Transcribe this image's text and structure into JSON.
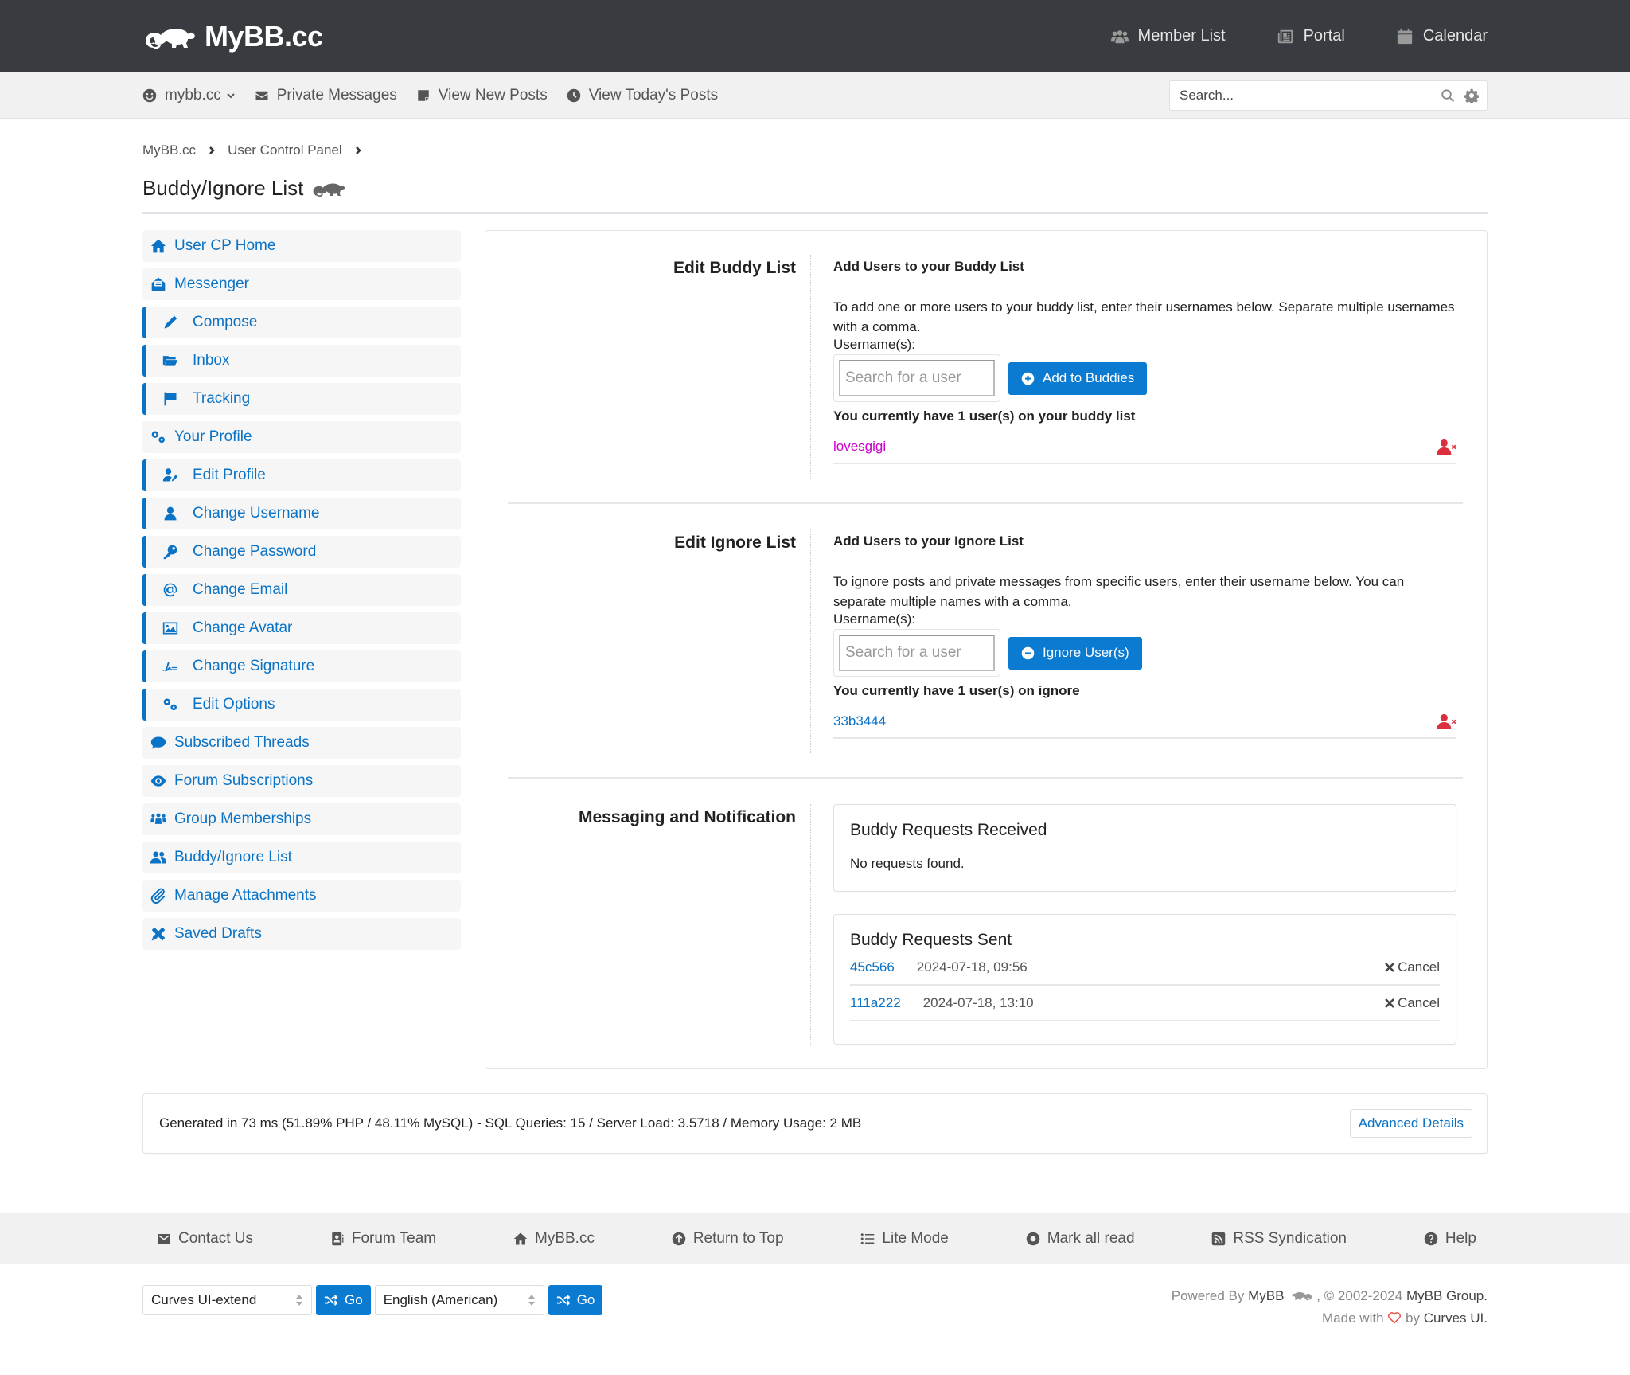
{
  "header": {
    "logo_text": "MyBB.cc",
    "nav": [
      {
        "label": "Member List",
        "icon": "users-icon"
      },
      {
        "label": "Portal",
        "icon": "newspaper-icon"
      },
      {
        "label": "Calendar",
        "icon": "calendar-icon"
      }
    ]
  },
  "subnav": {
    "user_menu": "mybb.cc",
    "links": [
      {
        "label": "Private Messages",
        "icon": "envelope-icon"
      },
      {
        "label": "View New Posts",
        "icon": "sticky-note-icon"
      },
      {
        "label": "View Today's Posts",
        "icon": "clock-icon"
      }
    ],
    "search_placeholder": "Search..."
  },
  "breadcrumb": [
    "MyBB.cc",
    "User Control Panel"
  ],
  "page_title": "Buddy/Ignore List",
  "sidebar": {
    "items": [
      {
        "label": "User CP Home",
        "icon": "home-icon",
        "sub": false
      },
      {
        "label": "Messenger",
        "icon": "envelope-open-icon",
        "sub": false
      },
      {
        "label": "Compose",
        "icon": "pen-icon",
        "sub": true
      },
      {
        "label": "Inbox",
        "icon": "folder-open-icon",
        "sub": true
      },
      {
        "label": "Tracking",
        "icon": "flag-icon",
        "sub": true
      },
      {
        "label": "Your Profile",
        "icon": "cogs-icon",
        "sub": false
      },
      {
        "label": "Edit Profile",
        "icon": "user-edit-icon",
        "sub": true
      },
      {
        "label": "Change Username",
        "icon": "user-icon",
        "sub": true
      },
      {
        "label": "Change Password",
        "icon": "key-icon",
        "sub": true
      },
      {
        "label": "Change Email",
        "icon": "at-icon",
        "sub": true
      },
      {
        "label": "Change Avatar",
        "icon": "image-icon",
        "sub": true
      },
      {
        "label": "Change Signature",
        "icon": "signature-icon",
        "sub": true
      },
      {
        "label": "Edit Options",
        "icon": "cogs-icon",
        "sub": true
      },
      {
        "label": "Subscribed Threads",
        "icon": "comment-icon",
        "sub": false
      },
      {
        "label": "Forum Subscriptions",
        "icon": "eye-icon",
        "sub": false
      },
      {
        "label": "Group Memberships",
        "icon": "users-group-icon",
        "sub": false
      },
      {
        "label": "Buddy/Ignore List",
        "icon": "user-friends-icon",
        "sub": false
      },
      {
        "label": "Manage Attachments",
        "icon": "paperclip-icon",
        "sub": false
      },
      {
        "label": "Saved Drafts",
        "icon": "pencil-ruler-icon",
        "sub": false
      }
    ]
  },
  "buddy": {
    "section_label": "Edit Buddy List",
    "title": "Add Users to your Buddy List",
    "description": "To add one or more users to your buddy list, enter their usernames below. Separate multiple usernames with a comma.",
    "field_label": "Username(s):",
    "placeholder": "Search for a user",
    "button": "Add to Buddies",
    "count_text": "You currently have 1 user(s) on your buddy list",
    "users": [
      {
        "name": "lovesgigi",
        "color": "#cc00cc"
      }
    ]
  },
  "ignore": {
    "section_label": "Edit Ignore List",
    "title": "Add Users to your Ignore List",
    "description": "To ignore posts and private messages from specific users, enter their username below. You can separate multiple names with a comma.",
    "field_label": "Username(s):",
    "placeholder": "Search for a user",
    "button": "Ignore User(s)",
    "count_text": "You currently have 1 user(s) on ignore",
    "users": [
      {
        "name": "33b3444",
        "color": "#0b73c6"
      }
    ]
  },
  "messaging": {
    "section_label": "Messaging and Notification",
    "received": {
      "title": "Buddy Requests Received",
      "empty": "No requests found."
    },
    "sent": {
      "title": "Buddy Requests Sent",
      "rows": [
        {
          "user": "45c566",
          "date": "2024-07-18, 09:56",
          "action": "Cancel"
        },
        {
          "user": "111a222",
          "date": "2024-07-18, 13:10",
          "action": "Cancel"
        }
      ]
    }
  },
  "debug": {
    "text": "Generated in 73 ms (51.89% PHP / 48.11% MySQL) - SQL Queries: 15 / Server Load: 3.5718 / Memory Usage: 2 MB",
    "button": "Advanced Details"
  },
  "footer": {
    "links": [
      {
        "label": "Contact Us",
        "icon": "envelope-icon"
      },
      {
        "label": "Forum Team",
        "icon": "address-book-icon"
      },
      {
        "label": "MyBB.cc",
        "icon": "home-icon"
      },
      {
        "label": "Return to Top",
        "icon": "arrow-up-circle-icon"
      },
      {
        "label": "Lite Mode",
        "icon": "list-icon"
      },
      {
        "label": "Mark all read",
        "icon": "dot-circle-icon"
      },
      {
        "label": "RSS Syndication",
        "icon": "rss-icon"
      },
      {
        "label": "Help",
        "icon": "question-circle-icon"
      }
    ],
    "theme_select": "Curves UI-extend",
    "language_select": "English (American)",
    "go_label": "Go",
    "powered_prefix": "Powered By",
    "powered_link": "MyBB",
    "copyright": ", © 2002-2024",
    "group_link": "MyBB Group.",
    "made_with": "Made with",
    "by": "by",
    "curves_link": "Curves UI."
  },
  "colors": {
    "header_bg": "#383b3f",
    "accent": "#0b7ad1",
    "link": "#0b73c6",
    "danger": "#dc2f3e",
    "buddy_name": "#cc00cc"
  }
}
